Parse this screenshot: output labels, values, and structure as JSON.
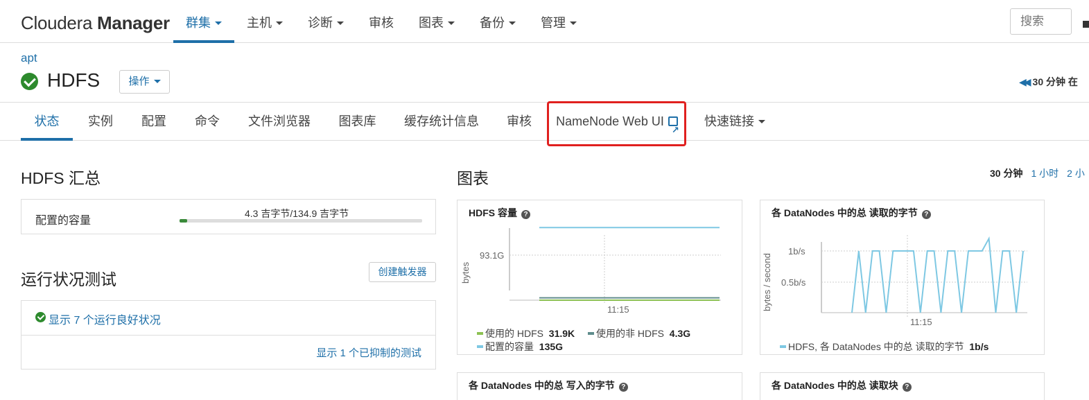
{
  "app": {
    "logo_light": "Cloudera ",
    "logo_bold": "Manager"
  },
  "nav": {
    "items": [
      {
        "label": "群集",
        "caret": true,
        "active": true
      },
      {
        "label": "主机",
        "caret": true
      },
      {
        "label": "诊断",
        "caret": true
      },
      {
        "label": "审核",
        "caret": false
      },
      {
        "label": "图表",
        "caret": true
      },
      {
        "label": "备份",
        "caret": true
      },
      {
        "label": "管理",
        "caret": true
      }
    ],
    "search_placeholder": "搜索"
  },
  "header": {
    "breadcrumb": "apt",
    "service_name": "HDFS",
    "actions_label": "操作",
    "time_control": "30 分钟 在"
  },
  "tabs": [
    {
      "label": "状态",
      "active": true
    },
    {
      "label": "实例"
    },
    {
      "label": "配置"
    },
    {
      "label": "命令"
    },
    {
      "label": "文件浏览器"
    },
    {
      "label": "图表库"
    },
    {
      "label": "缓存统计信息"
    },
    {
      "label": "审核"
    },
    {
      "label": "NameNode Web UI",
      "external": true
    },
    {
      "label": "快速链接",
      "caret": true
    }
  ],
  "summary": {
    "title": "HDFS 汇总",
    "capacity_label": "配置的容量",
    "capacity_text": "4.3 吉字节/134.9 吉字节",
    "capacity_used_fraction": 0.032
  },
  "health": {
    "title": "运行状况测试",
    "create_trigger_label": "创建触发器",
    "good_link": "显示 7 个运行良好状况",
    "suppressed_link": "显示 1 个已抑制的测试"
  },
  "charts_section": {
    "title": "图表",
    "ranges": [
      {
        "label": "30 分钟",
        "selected": true
      },
      {
        "label": "1 小时"
      },
      {
        "label": "2 小"
      }
    ]
  },
  "colors": {
    "accent": "#1e6fa8",
    "highlight": "#e0201f",
    "used_hdfs": "#8cc152",
    "used_non_hdfs": "#5f8c8c",
    "configured": "#7ec8e3"
  },
  "chart_data": [
    {
      "type": "line",
      "title": "HDFS 容量",
      "ylabel": "bytes",
      "y_tick_labels": [
        "93.1G"
      ],
      "x_tick_labels": [
        "11:15"
      ],
      "series": [
        {
          "name": "使用的 HDFS",
          "summary": "31.9K",
          "values": [
            3.19e-05,
            3.19e-05
          ]
        },
        {
          "name": "使用的非 HDFS",
          "summary": "4.3G",
          "values": [
            4.3,
            4.3
          ]
        },
        {
          "name": "配置的容量",
          "summary": "135G",
          "values": [
            135,
            135
          ]
        }
      ]
    },
    {
      "type": "line",
      "title": "各 DataNodes 中的总 读取的字节",
      "ylabel": "bytes / second",
      "y_tick_labels": [
        "1b/s",
        "0.5b/s"
      ],
      "x_tick_labels": [
        "11:15"
      ],
      "ylim": [
        0,
        1.2
      ],
      "series": [
        {
          "name": "HDFS, 各 DataNodes 中的总 读取的字节",
          "summary": "1b/s",
          "values": [
            0,
            1,
            0,
            1,
            1,
            0,
            1,
            1,
            1,
            1,
            0,
            1,
            1,
            0,
            1,
            1,
            0,
            1,
            1,
            1,
            1.2,
            0,
            1,
            1,
            0,
            1
          ]
        }
      ]
    },
    {
      "type": "line",
      "title": "各 DataNodes 中的总 写入的字节"
    },
    {
      "type": "line",
      "title": "各 DataNodes 中的总 读取块"
    }
  ]
}
